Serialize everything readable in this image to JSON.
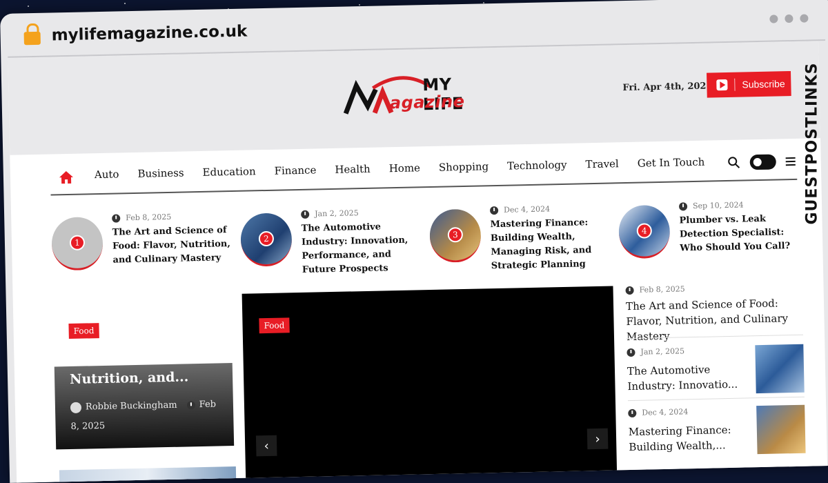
{
  "browser": {
    "url": "mylifemagazine.co.uk"
  },
  "header": {
    "logo_line1": "MY LIFE",
    "logo_line2": "agazine",
    "date": "Fri. Apr 4th, 2025",
    "subscribe_label": "Subscribe"
  },
  "watermark": "GUESTPOSTLINKS",
  "nav": {
    "items": [
      "Auto",
      "Business",
      "Education",
      "Finance",
      "Health",
      "Home",
      "Shopping",
      "Technology",
      "Travel",
      "Get In Touch"
    ]
  },
  "trending": [
    {
      "num": "1",
      "date": "Feb 8, 2025",
      "title": "The Art and Science of Food: Flavor, Nutrition, and Culinary Mastery"
    },
    {
      "num": "2",
      "date": "Jan 2, 2025",
      "title": "The Automotive Industry: Innovation, Performance, and Future Prospects"
    },
    {
      "num": "3",
      "date": "Dec 4, 2024",
      "title": "Mastering Finance: Building Wealth, Managing Risk, and Strategic Planning"
    },
    {
      "num": "4",
      "date": "Sep 10, 2024",
      "title": "Plumber vs. Leak Detection Specialist: Who Should You Call?"
    }
  ],
  "left_card": {
    "category": "Food",
    "title": "Nutrition, and...",
    "author": "Robbie Buckingham",
    "date": "Feb 8, 2025"
  },
  "hero": {
    "category": "Food",
    "prev": "‹",
    "next": "›"
  },
  "right_list": [
    {
      "date": "Feb 8, 2025",
      "title": "The Art and Science of Food: Flavor, Nutrition, and Culinary Mastery"
    },
    {
      "date": "Jan 2, 2025",
      "title": "The Automotive Industry: Innovatio..."
    },
    {
      "date": "Dec 4, 2024",
      "title": "Mastering Finance: Building Wealth,..."
    }
  ],
  "colors": {
    "accent": "#e81d25",
    "dark": "#111111"
  }
}
